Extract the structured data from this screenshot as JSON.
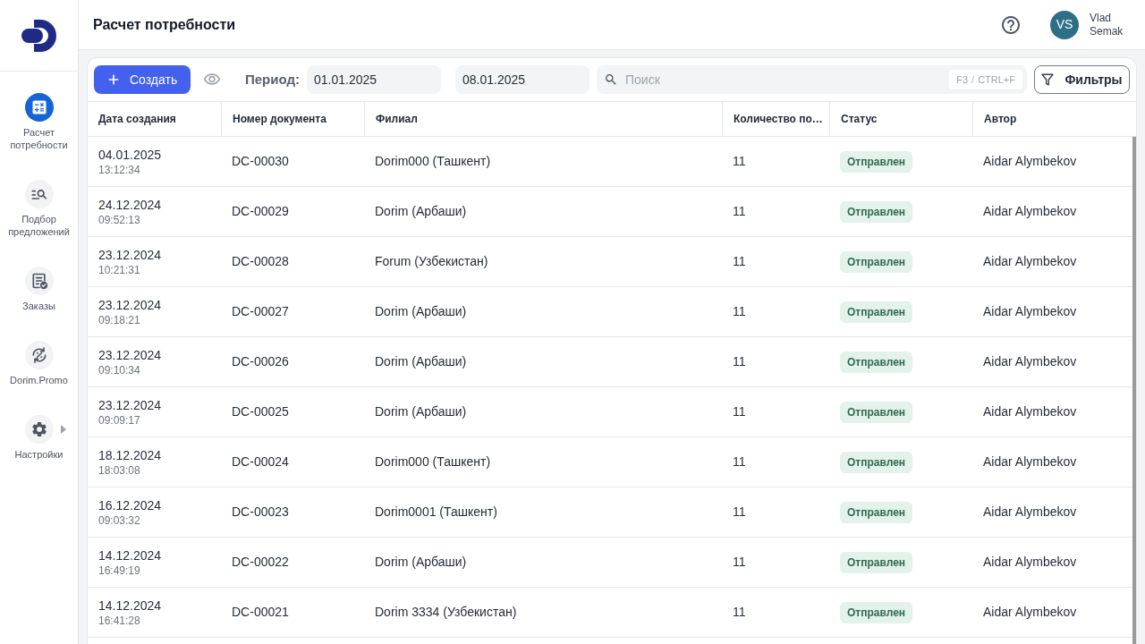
{
  "sidebar": {
    "items": [
      {
        "label": "Расчет потребности",
        "selected": true,
        "has_submenu": false
      },
      {
        "label": "Подбор предложений",
        "selected": false,
        "has_submenu": false
      },
      {
        "label": "Заказы",
        "selected": false,
        "has_submenu": false
      },
      {
        "label": "Dorim.Promo",
        "selected": false,
        "has_submenu": false
      },
      {
        "label": "Настройки",
        "selected": false,
        "has_submenu": true
      }
    ]
  },
  "header": {
    "title": "Расчет потребности",
    "user": {
      "initials": "VS",
      "name": "Vlad Semak"
    }
  },
  "toolbar": {
    "create_button": "Создать",
    "period_label": "Период:",
    "date_from": "01.01.2025",
    "date_to": "08.01.2025",
    "search": {
      "placeholder": "Поиск",
      "shortcut_keys": [
        "F3",
        "CTRL+F"
      ],
      "shortcut_separator": "/"
    },
    "filters_button": "Фильтры"
  },
  "table": {
    "columns": [
      "Дата создания",
      "Номер документа",
      "Филиал",
      "Количество по…",
      "Статус",
      "Автор"
    ],
    "rows": [
      {
        "date": "04.01.2025",
        "time": "13:12:34",
        "number": "DC-00030",
        "branch": "Dorim000 (Ташкент)",
        "count": "11",
        "status": "Отправлен",
        "author": "Aidar Alymbekov"
      },
      {
        "date": "24.12.2024",
        "time": "09:52:13",
        "number": "DC-00029",
        "branch": "Dorim (Арбаши)",
        "count": "11",
        "status": "Отправлен",
        "author": "Aidar Alymbekov"
      },
      {
        "date": "23.12.2024",
        "time": "10:21:31",
        "number": "DC-00028",
        "branch": "Forum (Узбекистан)",
        "count": "11",
        "status": "Отправлен",
        "author": "Aidar Alymbekov"
      },
      {
        "date": "23.12.2024",
        "time": "09:18:21",
        "number": "DC-00027",
        "branch": "Dorim (Арбаши)",
        "count": "11",
        "status": "Отправлен",
        "author": "Aidar Alymbekov"
      },
      {
        "date": "23.12.2024",
        "time": "09:10:34",
        "number": "DC-00026",
        "branch": "Dorim (Арбаши)",
        "count": "11",
        "status": "Отправлен",
        "author": "Aidar Alymbekov"
      },
      {
        "date": "23.12.2024",
        "time": "09:09:17",
        "number": "DC-00025",
        "branch": "Dorim (Арбаши)",
        "count": "11",
        "status": "Отправлен",
        "author": "Aidar Alymbekov"
      },
      {
        "date": "18.12.2024",
        "time": "18:03:08",
        "number": "DC-00024",
        "branch": "Dorim000 (Ташкент)",
        "count": "11",
        "status": "Отправлен",
        "author": "Aidar Alymbekov"
      },
      {
        "date": "16.12.2024",
        "time": "09:03:32",
        "number": "DC-00023",
        "branch": "Dorim0001 (Ташкент)",
        "count": "11",
        "status": "Отправлен",
        "author": "Aidar Alymbekov"
      },
      {
        "date": "14.12.2024",
        "time": "16:49:19",
        "number": "DC-00022",
        "branch": "Dorim (Арбаши)",
        "count": "11",
        "status": "Отправлен",
        "author": "Aidar Alymbekov"
      },
      {
        "date": "14.12.2024",
        "time": "16:41:28",
        "number": "DC-00021",
        "branch": "Dorim 3334 (Узбекистан)",
        "count": "11",
        "status": "Отправлен",
        "author": "Aidar Alymbekov"
      }
    ]
  }
}
